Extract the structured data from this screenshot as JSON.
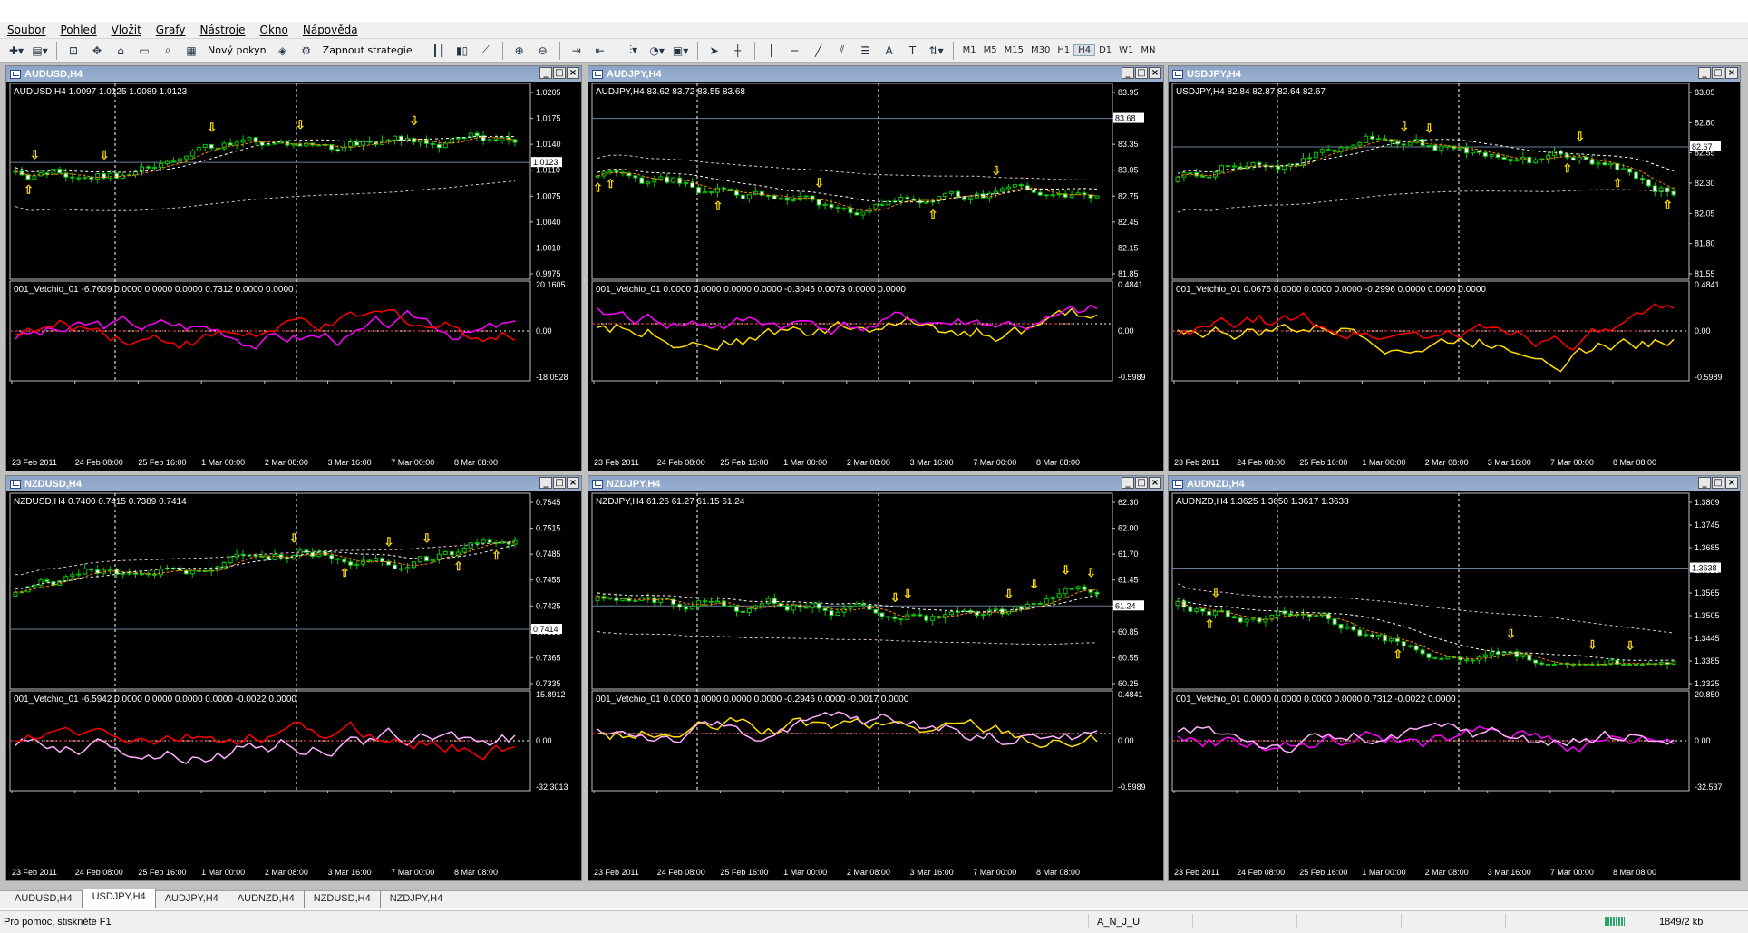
{
  "menu": [
    "Soubor",
    "Pohled",
    "Vložit",
    "Grafy",
    "Nástroje",
    "Okno",
    "Nápověda"
  ],
  "toolbar": {
    "new_order": "Nový pokyn",
    "strategies": "Zapnout strategie",
    "timeframes": [
      "M1",
      "M5",
      "M15",
      "M30",
      "H1",
      "H4",
      "D1",
      "W1",
      "MN"
    ],
    "active_timeframe": "H4"
  },
  "windows": [
    {
      "title": "AUDUSD,H4",
      "info": "AUDUSD,H4  1.0097 1.0125 1.0089 1.0123",
      "price_ticks": [
        "1.0205",
        "1.0175",
        "1.0140",
        "1.0110",
        "1.0075",
        "1.0040",
        "1.0010",
        "0.9975"
      ],
      "current_price": "1.0123",
      "indicator_info": "001_Vetchio_01 -6.7609 0.0000 0.0000 0.0000 0.7312 0.0000 0.0000",
      "indicator_ticks": [
        "20.1605",
        "0.00",
        "-18.0528"
      ],
      "date_ticks": [
        "23 Feb 2011",
        "24 Feb 08:00",
        "25 Feb 16:00",
        "1 Mar 00:00",
        "2 Mar 08:00",
        "3 Mar 16:00",
        "7 Mar 00:00",
        "8 Mar 08:00"
      ],
      "series_colors": [
        "#ff00ff",
        "#ff0000"
      ]
    },
    {
      "title": "AUDJPY,H4",
      "info": "AUDJPY,H4  83.62 83.72 83.55 83.68",
      "price_ticks": [
        "83.95",
        "83.65",
        "83.35",
        "83.05",
        "82.75",
        "82.45",
        "82.15",
        "81.85"
      ],
      "current_price": "83.68",
      "indicator_info": "001_Vetchio_01 0.0000 0.0000 0.0000 0.0000 -0.3046 0.0073 0.0000 0.0000",
      "indicator_ticks": [
        "0.4841",
        "0.00",
        "-0.5989"
      ],
      "date_ticks": [
        "23 Feb 2011",
        "24 Feb 08:00",
        "25 Feb 16:00",
        "1 Mar 00:00",
        "2 Mar 08:00",
        "3 Mar 16:00",
        "7 Mar 00:00",
        "8 Mar 08:00"
      ],
      "series_colors": [
        "#ffdd00",
        "#ff00ff"
      ]
    },
    {
      "title": "USDJPY,H4",
      "info": "USDJPY,H4  82.84 82.87 82.64 82.67",
      "price_ticks": [
        "83.05",
        "82.80",
        "82.55",
        "82.30",
        "82.05",
        "81.80",
        "81.55"
      ],
      "current_price": "82.67",
      "indicator_info": "001_Vetchio_01 0.0676 0.0000 0.0000 0.0000 -0.2996 0.0000 0.0000 0.0000",
      "indicator_ticks": [
        "0.4841",
        "0.00",
        "-0.5989"
      ],
      "date_ticks": [
        "23 Feb 2011",
        "24 Feb 08:00",
        "25 Feb 16:00",
        "1 Mar 00:00",
        "2 Mar 08:00",
        "3 Mar 16:00",
        "7 Mar 00:00",
        "8 Mar 08:00"
      ],
      "series_colors": [
        "#ffdd00",
        "#ff0000"
      ]
    },
    {
      "title": "NZDUSD,H4",
      "info": "NZDUSD,H4  0.7400 0.7415 0.7389 0.7414",
      "price_ticks": [
        "0.7545",
        "0.7515",
        "0.7485",
        "0.7455",
        "0.7425",
        "0.7395",
        "0.7365",
        "0.7335"
      ],
      "current_price": "0.7414",
      "indicator_info": "001_Vetchio_01 -6.5942 0.0000 0.0000 0.0000 0.0000 -0.0022 0.0000",
      "indicator_ticks": [
        "15.8912",
        "0.00",
        "-32.3013"
      ],
      "date_ticks": [
        "23 Feb 2011",
        "24 Feb 08:00",
        "25 Feb 16:00",
        "1 Mar 00:00",
        "2 Mar 08:00",
        "3 Mar 16:00",
        "7 Mar 00:00",
        "8 Mar 08:00"
      ],
      "series_colors": [
        "#ffb0ff",
        "#ff0000"
      ]
    },
    {
      "title": "NZDJPY,H4",
      "info": "NZDJPY,H4  61.26 61.27 61.15 61.24",
      "price_ticks": [
        "62.30",
        "62.00",
        "61.70",
        "61.45",
        "61.15",
        "60.85",
        "60.55",
        "60.25"
      ],
      "current_price": "61.24",
      "indicator_info": "001_Vetchio_01 0.0000 0.0000 0.0000 0.0000 -0.2946 0.0000 -0.0017 0.0000",
      "indicator_ticks": [
        "0.4841",
        "0.00",
        "-0.5989"
      ],
      "date_ticks": [
        "23 Feb 2011",
        "24 Feb 08:00",
        "25 Feb 16:00",
        "1 Mar 00:00",
        "2 Mar 08:00",
        "3 Mar 16:00",
        "7 Mar 00:00",
        "8 Mar 08:00"
      ],
      "series_colors": [
        "#ffdd00",
        "#ffb0ff"
      ]
    },
    {
      "title": "AUDNZD,H4",
      "info": "AUDNZD,H4  1.3625 1.3650 1.3617 1.3638",
      "price_ticks": [
        "1.3809",
        "1.3745",
        "1.3685",
        "1.3625",
        "1.3565",
        "1.3505",
        "1.3445",
        "1.3385",
        "1.3325"
      ],
      "current_price": "1.3638",
      "indicator_info": "001_Vetchio_01 0.0000 0.0000 0.0000 0.0000 0.7312 -0.0022 0.0000",
      "indicator_ticks": [
        "20.850",
        "0.00",
        "-32.537"
      ],
      "date_ticks": [
        "23 Feb 2011",
        "24 Feb 08:00",
        "25 Feb 16:00",
        "1 Mar 00:00",
        "2 Mar 08:00",
        "3 Mar 16:00",
        "7 Mar 00:00",
        "8 Mar 08:00"
      ],
      "series_colors": [
        "#ff00ff",
        "#ffb0ff"
      ]
    }
  ],
  "tabs": [
    "AUDUSD,H4",
    "USDJPY,H4",
    "AUDJPY,H4",
    "AUDNZD,H4",
    "NZDUSD,H4",
    "NZDJPY,H4"
  ],
  "active_tab": "USDJPY,H4",
  "status": {
    "help": "Pro pomoc, stiskněte F1",
    "profile": "A_N_J_U",
    "traffic": "1849/2 kb"
  }
}
